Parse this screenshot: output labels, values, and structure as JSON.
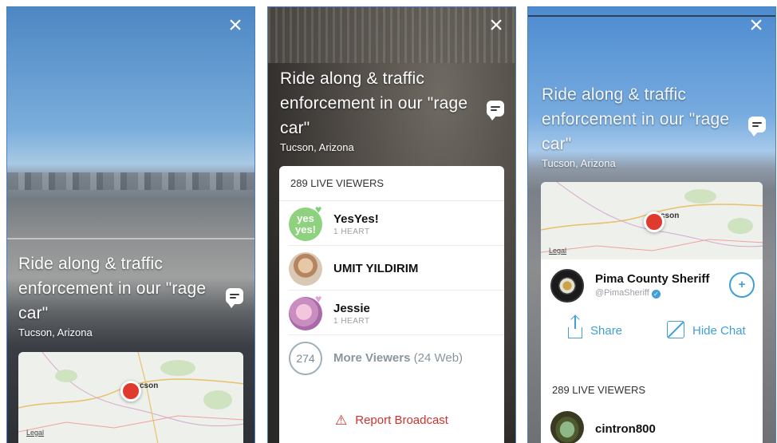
{
  "broadcast": {
    "title": "Ride along & traffic enforcement in our \"rage car\"",
    "location": "Tucson, Arizona"
  },
  "map": {
    "city_label": "cson",
    "legal": "Legal"
  },
  "viewers_panel": {
    "header": "289 LIVE VIEWERS",
    "viewers": [
      {
        "name": "YesYes!",
        "sub": "1 HEART",
        "avatar_text": "yes yes!"
      },
      {
        "name": "UMIT YILDIRIM",
        "sub": ""
      },
      {
        "name": "Jessie",
        "sub": "1 HEART"
      }
    ],
    "more_count": "274",
    "more_label": "More Viewers",
    "more_web": "(24 Web)",
    "report": "Report Broadcast"
  },
  "profile": {
    "name": "Pima County Sheriff",
    "handle": "@PimaSheriff",
    "share_label": "Share",
    "hide_chat_label": "Hide Chat",
    "live_viewers": "289 LIVE VIEWERS",
    "first_viewer": "cintron800"
  },
  "colors": {
    "accent": "#3f9fd6",
    "report_red": "#d0312d",
    "pin_red": "#e03a2e",
    "heart_green": "#7dd17a"
  }
}
